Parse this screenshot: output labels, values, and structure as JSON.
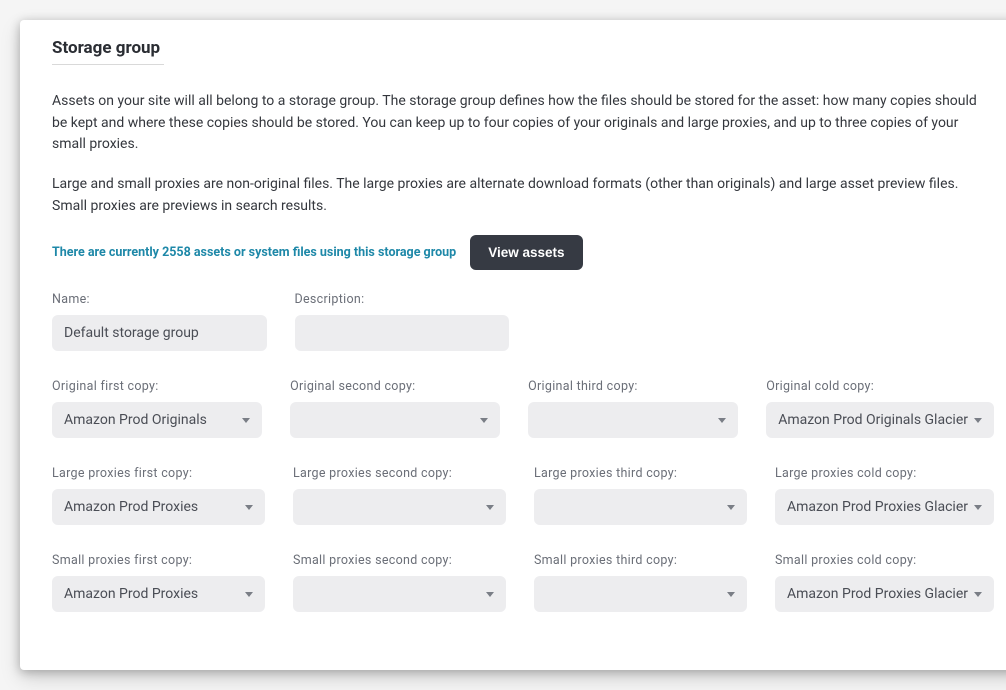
{
  "section_title": "Storage group",
  "description_p1": "Assets on your site will all belong to a storage group. The storage group defines how the files should be stored for the asset: how many copies should be kept and where these copies should be stored. You can keep up to four copies of your originals and large proxies, and up to three copies of your small proxies.",
  "description_p2": "Large and small proxies are non-original files. The large proxies are alternate download formats (other than originals) and large asset preview files. Small proxies are previews in search results.",
  "asset_count_text": "There are currently 2558 assets or system files using this storage group",
  "view_assets_label": "View assets",
  "fields": {
    "name": {
      "label": "Name:",
      "value": "Default storage group"
    },
    "description": {
      "label": "Description:",
      "value": ""
    }
  },
  "rows": [
    {
      "cols": [
        {
          "label": "Original first copy:",
          "value": "Amazon Prod Originals",
          "name": "original-first-copy"
        },
        {
          "label": "Original second copy:",
          "value": "",
          "name": "original-second-copy"
        },
        {
          "label": "Original third copy:",
          "value": "",
          "name": "original-third-copy"
        },
        {
          "label": "Original cold copy:",
          "value": "Amazon Prod Originals Glacier",
          "name": "original-cold-copy"
        }
      ]
    },
    {
      "cols": [
        {
          "label": "Large proxies first copy:",
          "value": "Amazon Prod Proxies",
          "name": "large-first-copy"
        },
        {
          "label": "Large proxies second copy:",
          "value": "",
          "name": "large-second-copy"
        },
        {
          "label": "Large proxies third copy:",
          "value": "",
          "name": "large-third-copy"
        },
        {
          "label": "Large proxies cold copy:",
          "value": "Amazon Prod Proxies Glacier",
          "name": "large-cold-copy"
        }
      ]
    },
    {
      "cols": [
        {
          "label": "Small proxies first copy:",
          "value": "Amazon Prod Proxies",
          "name": "small-first-copy"
        },
        {
          "label": "Small proxies second copy:",
          "value": "",
          "name": "small-second-copy"
        },
        {
          "label": "Small proxies third copy:",
          "value": "",
          "name": "small-third-copy"
        },
        {
          "label": "Small proxies cold copy:",
          "value": "Amazon Prod Proxies Glacier",
          "name": "small-cold-copy"
        }
      ]
    }
  ]
}
